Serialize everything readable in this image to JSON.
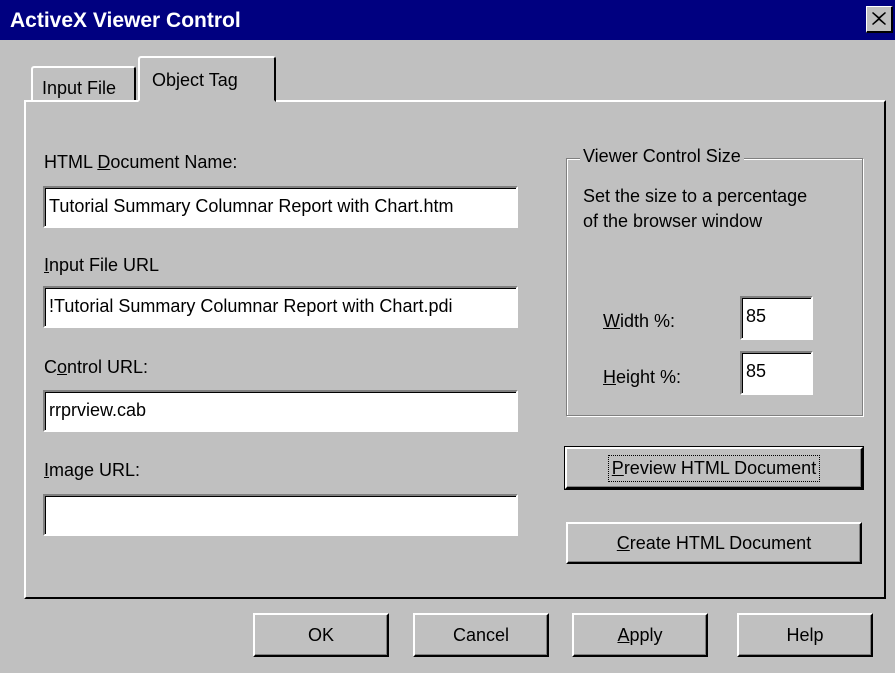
{
  "window": {
    "title": "ActiveX Viewer Control",
    "close_label": "×"
  },
  "tabs": [
    {
      "label": "Input File",
      "selected": false
    },
    {
      "label": "Object Tag",
      "selected": true
    }
  ],
  "form": {
    "html_doc_name": {
      "label_pre": "HTML ",
      "label_access": "D",
      "label_post": "ocument Name:",
      "value": "Tutorial Summary Columnar Report with Chart.htm"
    },
    "input_file_url": {
      "label_pre": "",
      "label_access": "I",
      "label_post": "nput File URL",
      "value": "!Tutorial Summary Columnar Report with Chart.pdi"
    },
    "control_url": {
      "label_pre": "C",
      "label_access": "o",
      "label_post": "ntrol URL:",
      "value": "rrprview.cab"
    },
    "image_url": {
      "label_pre": "",
      "label_access": "I",
      "label_post": "mage URL:",
      "value": ""
    }
  },
  "viewer_size": {
    "legend": "Viewer Control Size",
    "description_line1": "Set the size to a percentage",
    "description_line2": "of the browser window",
    "width": {
      "label_access": "W",
      "label_post": "idth %:",
      "value": "85"
    },
    "height": {
      "label_access": "H",
      "label_post": "eight %:",
      "value": "85"
    }
  },
  "buttons": {
    "preview": {
      "access": "P",
      "rest": "review HTML Document"
    },
    "create": {
      "access": "C",
      "rest": "reate HTML Document"
    },
    "ok": "OK",
    "cancel": "Cancel",
    "apply": {
      "access": "A",
      "rest": "pply"
    },
    "help": "Help"
  }
}
